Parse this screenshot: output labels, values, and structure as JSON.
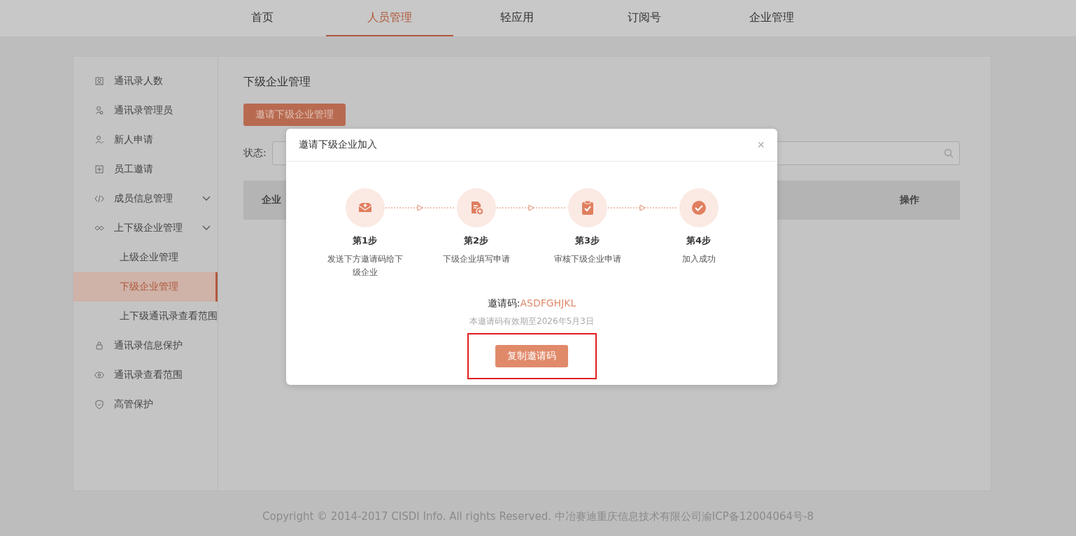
{
  "nav": [
    {
      "label": "首页",
      "selected": false
    },
    {
      "label": "人员管理",
      "selected": true
    },
    {
      "label": "轻应用",
      "selected": false
    },
    {
      "label": "订阅号",
      "selected": false
    },
    {
      "label": "企业管理",
      "selected": false
    }
  ],
  "sidebar": {
    "items": [
      {
        "label": "通讯录人数",
        "kind": "link",
        "selected": false
      },
      {
        "label": "通讯录管理员",
        "kind": "link",
        "selected": false
      },
      {
        "label": "新人申请",
        "kind": "link",
        "selected": false
      },
      {
        "label": "员工邀请",
        "kind": "link",
        "selected": false
      },
      {
        "label": "成员信息管理",
        "kind": "group",
        "selected": false
      },
      {
        "label": "上下级企业管理",
        "kind": "group",
        "selected": false,
        "children": [
          {
            "label": "上级企业管理",
            "selected": false
          },
          {
            "label": "下级企业管理",
            "selected": true
          },
          {
            "label": "上下级通讯录查看范围",
            "selected": false
          }
        ]
      },
      {
        "label": "通讯录信息保护",
        "kind": "link",
        "selected": false
      },
      {
        "label": "通讯录查看范围",
        "kind": "link",
        "selected": false
      },
      {
        "label": "高管保护",
        "kind": "link",
        "selected": false
      }
    ]
  },
  "content": {
    "title": "下级企业管理",
    "invite_button": "邀请下级企业管理",
    "status_label": "状态:",
    "table": {
      "columns": [
        "企业",
        "操作"
      ]
    }
  },
  "dialog": {
    "title": "邀请下级企业加入",
    "close": "×",
    "steps": [
      {
        "title": "第1步",
        "text": "发送下方邀请码给下级企业"
      },
      {
        "title": "第2步",
        "text": "下级企业填写申请"
      },
      {
        "title": "第3步",
        "text": "审核下级企业申请"
      },
      {
        "title": "第4步",
        "text": "加入成功"
      }
    ],
    "code_label": "邀请码:",
    "code": "ASDFGHJKL",
    "validity": "本邀请码有效期至2026年5月3日",
    "copy_button": "复制邀请码",
    "highlighted": true
  },
  "footer": "Copyright © 2014-2017 CISDI Info. All rights Reserved. 中冶赛迪重庆信息技术有限公司渝ICP备12004064号-8"
}
